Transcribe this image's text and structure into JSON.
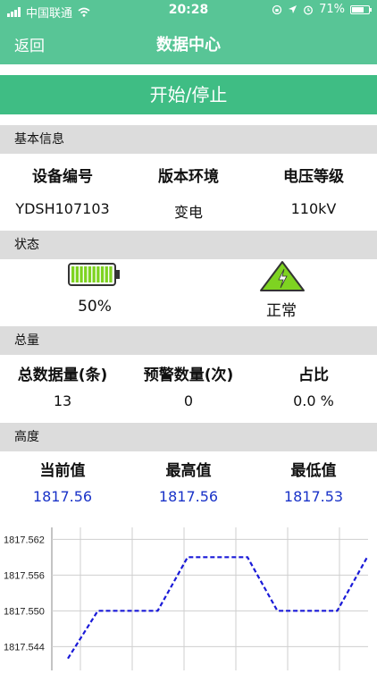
{
  "status_bar": {
    "carrier": "中国联通",
    "time": "20:28",
    "battery": "71%",
    "battery_level": 0.71
  },
  "nav": {
    "back": "返回",
    "title": "数据中心"
  },
  "start_button": "开始/停止",
  "basic_info": {
    "header": "基本信息",
    "columns": [
      {
        "label": "设备编号",
        "value": "YDSH107103"
      },
      {
        "label": "版本环境",
        "value": "变电"
      },
      {
        "label": "电压等级",
        "value": "110kV"
      }
    ]
  },
  "status": {
    "header": "状态",
    "battery_text": "50%",
    "battery_level": 0.5,
    "state_text": "正常",
    "colors": {
      "battery": "#7ed321",
      "warning": "#7ed321"
    }
  },
  "total": {
    "header": "总量",
    "columns": [
      {
        "label": "总数据量(条)",
        "value": "13"
      },
      {
        "label": "预警数量(次)",
        "value": "0"
      },
      {
        "label": "占比",
        "value": "0.0 %"
      }
    ]
  },
  "height": {
    "header": "高度",
    "columns": [
      {
        "label": "当前值",
        "value": "1817.56"
      },
      {
        "label": "最高值",
        "value": "1817.56"
      },
      {
        "label": "最低值",
        "value": "1817.53"
      }
    ]
  },
  "chart_data": {
    "type": "line",
    "y_ticks": [
      "1817.562",
      "1817.556",
      "1817.550",
      "1817.544"
    ],
    "ylim": [
      1817.54,
      1817.564
    ],
    "series": [
      {
        "values": [
          1817.542,
          1817.55,
          1817.55,
          1817.55,
          1817.559,
          1817.559,
          1817.559,
          1817.55,
          1817.55,
          1817.55,
          1817.559
        ]
      }
    ],
    "line_color": "#1a1ad8",
    "grid": true
  }
}
